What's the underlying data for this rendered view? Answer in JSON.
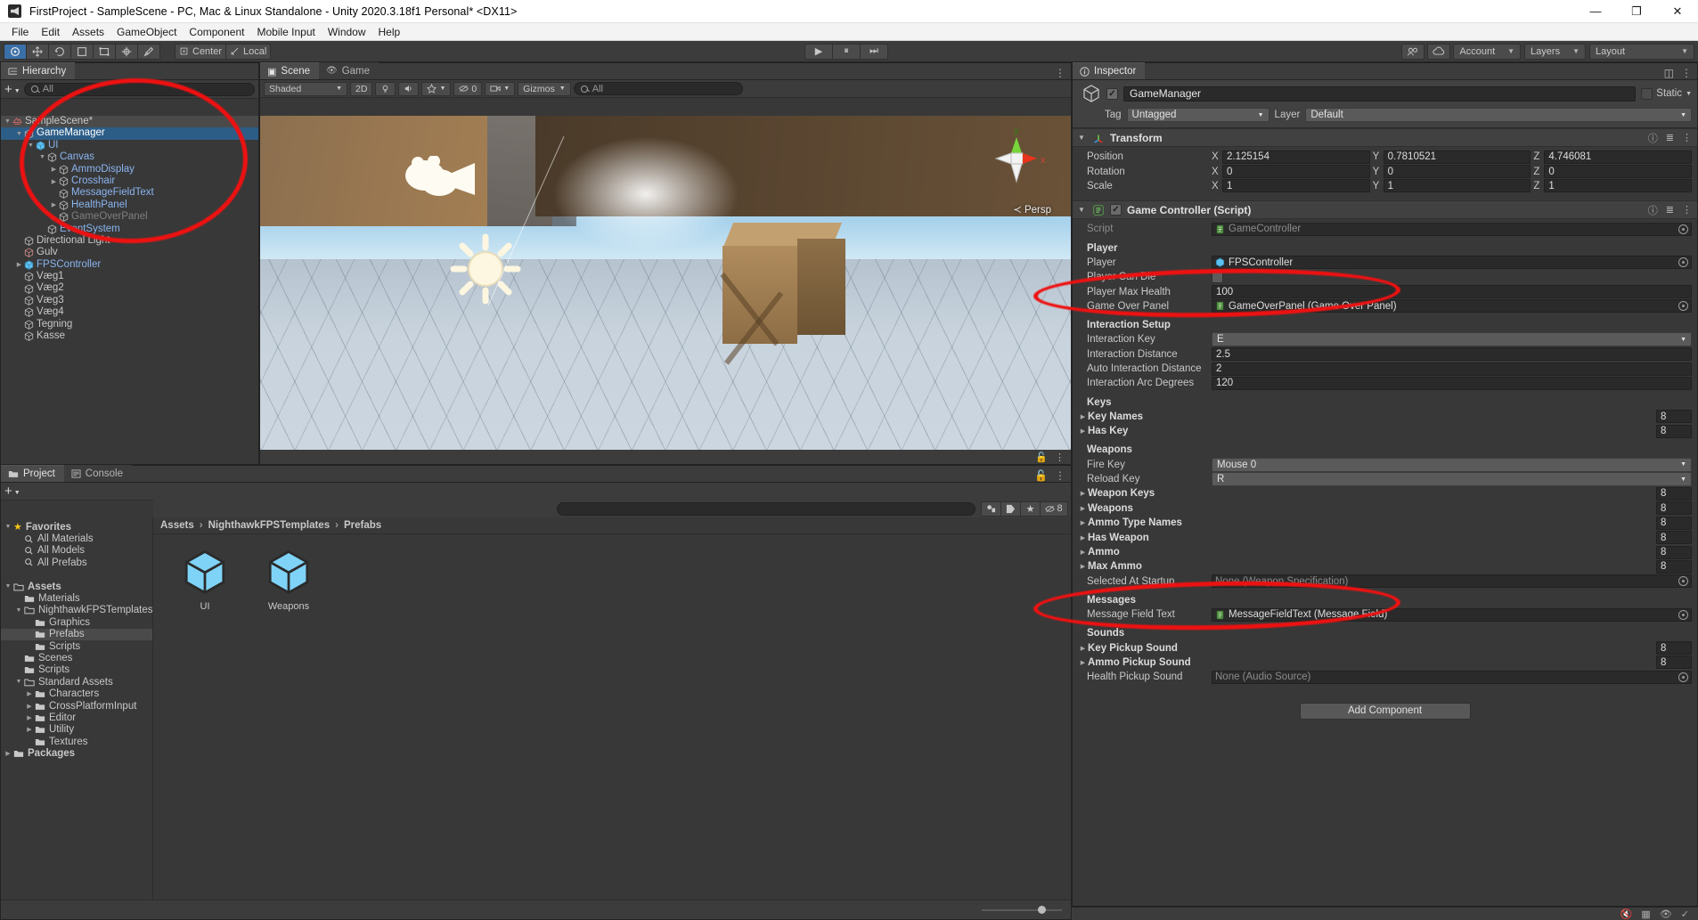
{
  "window": {
    "title": "FirstProject - SampleScene - PC, Mac & Linux Standalone - Unity 2020.3.18f1 Personal* <DX11>",
    "minimize": "—",
    "maximize": "❐",
    "close": "✕"
  },
  "menu": [
    "File",
    "Edit",
    "Assets",
    "GameObject",
    "Component",
    "Mobile Input",
    "Window",
    "Help"
  ],
  "toolbar": {
    "transform_tools": [
      "hand",
      "move",
      "rotate",
      "rect",
      "scale",
      "transform",
      "custom"
    ],
    "pivot_mode": "Center",
    "pivot_rotation": "Local",
    "play": "▶",
    "pause": "⏸",
    "step": "⏭",
    "collab": "Collab",
    "cloud": "cloud-icon",
    "account": "Account",
    "layers": "Layers",
    "layout": "Layout"
  },
  "hierarchy": {
    "tab": "Hierarchy",
    "search_placeholder": "All",
    "add_label": "+",
    "items": [
      {
        "label": "SampleScene*",
        "depth": 0,
        "arrow": "down",
        "icon": "scene-icon",
        "state": "scene"
      },
      {
        "label": "GameManager",
        "depth": 1,
        "arrow": "down",
        "icon": "cube-icon",
        "state": "selected"
      },
      {
        "label": "UI",
        "depth": 2,
        "arrow": "down",
        "icon": "prefab-icon",
        "state": "prefab"
      },
      {
        "label": "Canvas",
        "depth": 3,
        "arrow": "down",
        "icon": "cube-icon",
        "state": "child"
      },
      {
        "label": "AmmoDisplay",
        "depth": 4,
        "arrow": "right",
        "icon": "cube-icon",
        "state": "child"
      },
      {
        "label": "Crosshair",
        "depth": 4,
        "arrow": "right",
        "icon": "cube-icon",
        "state": "child"
      },
      {
        "label": "MessageFieldText",
        "depth": 4,
        "arrow": "none",
        "icon": "cube-icon",
        "state": "child"
      },
      {
        "label": "HealthPanel",
        "depth": 4,
        "arrow": "right",
        "icon": "cube-icon",
        "state": "child"
      },
      {
        "label": "GameOverPanel",
        "depth": 4,
        "arrow": "right",
        "icon": "cube-icon",
        "state": "disabled"
      },
      {
        "label": "EventSystem",
        "depth": 3,
        "arrow": "none",
        "icon": "cube-icon",
        "state": "child"
      },
      {
        "label": "Directional Light",
        "depth": 1,
        "arrow": "none",
        "icon": "cube-icon",
        "state": "normal"
      },
      {
        "label": "Gulv",
        "depth": 1,
        "arrow": "none",
        "icon": "cube-icon",
        "state": "normal"
      },
      {
        "label": "FPSController",
        "depth": 1,
        "arrow": "right",
        "icon": "prefab-icon",
        "state": "prefab"
      },
      {
        "label": "Væg1",
        "depth": 1,
        "arrow": "none",
        "icon": "cube-icon",
        "state": "normal"
      },
      {
        "label": "Væg2",
        "depth": 1,
        "arrow": "none",
        "icon": "cube-icon",
        "state": "normal"
      },
      {
        "label": "Væg3",
        "depth": 1,
        "arrow": "none",
        "icon": "cube-icon",
        "state": "normal"
      },
      {
        "label": "Væg4",
        "depth": 1,
        "arrow": "none",
        "icon": "cube-icon",
        "state": "normal"
      },
      {
        "label": "Tegning",
        "depth": 1,
        "arrow": "none",
        "icon": "cube-icon",
        "state": "normal"
      },
      {
        "label": "Kasse",
        "depth": 1,
        "arrow": "none",
        "icon": "cube-icon",
        "state": "normal"
      }
    ]
  },
  "scene": {
    "tabs": [
      {
        "label": "Scene",
        "icon": "scene-icon",
        "active": true
      },
      {
        "label": "Game",
        "icon": "game-icon",
        "active": false
      }
    ],
    "shading": "Shaded",
    "mode_2d": "2D",
    "gizmos": "Gizmos",
    "search_placeholder": "All",
    "audio_toggle": "audio-icon",
    "fx_toggle": "fx-icon",
    "count_badge": "0",
    "perspective_label": "Persp",
    "axis_labels": {
      "x": "x",
      "y": "y"
    }
  },
  "project": {
    "tabs": [
      {
        "label": "Project",
        "icon": "folder-icon",
        "active": true
      },
      {
        "label": "Console",
        "icon": "console-icon",
        "active": false
      }
    ],
    "search_placeholder": "",
    "hidden_count": "8",
    "breadcrumb": [
      "Assets",
      "NighthawkFPSTemplates",
      "Prefabs"
    ],
    "tree": [
      {
        "label": "Favorites",
        "depth": 0,
        "arrow": "down",
        "icon": "star-icon",
        "bold": true,
        "sel": false
      },
      {
        "label": "All Materials",
        "depth": 1,
        "arrow": "none",
        "icon": "search-icon",
        "bold": false,
        "sel": false
      },
      {
        "label": "All Models",
        "depth": 1,
        "arrow": "none",
        "icon": "search-icon",
        "bold": false,
        "sel": false
      },
      {
        "label": "All Prefabs",
        "depth": 1,
        "arrow": "none",
        "icon": "search-icon",
        "bold": false,
        "sel": false
      },
      {
        "label": "",
        "depth": 0,
        "arrow": "none",
        "icon": "none",
        "bold": false,
        "sel": false
      },
      {
        "label": "Assets",
        "depth": 0,
        "arrow": "down",
        "icon": "folder-open-icon",
        "bold": true,
        "sel": false
      },
      {
        "label": "Materials",
        "depth": 1,
        "arrow": "none",
        "icon": "folder-icon",
        "bold": false,
        "sel": false
      },
      {
        "label": "NighthawkFPSTemplates",
        "depth": 1,
        "arrow": "down",
        "icon": "folder-open-icon",
        "bold": false,
        "sel": false
      },
      {
        "label": "Graphics",
        "depth": 2,
        "arrow": "none",
        "icon": "folder-icon",
        "bold": false,
        "sel": false
      },
      {
        "label": "Prefabs",
        "depth": 2,
        "arrow": "none",
        "icon": "folder-icon",
        "bold": false,
        "sel": true
      },
      {
        "label": "Scripts",
        "depth": 2,
        "arrow": "none",
        "icon": "folder-icon",
        "bold": false,
        "sel": false
      },
      {
        "label": "Scenes",
        "depth": 1,
        "arrow": "none",
        "icon": "folder-icon",
        "bold": false,
        "sel": false
      },
      {
        "label": "Scripts",
        "depth": 1,
        "arrow": "none",
        "icon": "folder-icon",
        "bold": false,
        "sel": false
      },
      {
        "label": "Standard Assets",
        "depth": 1,
        "arrow": "down",
        "icon": "folder-open-icon",
        "bold": false,
        "sel": false
      },
      {
        "label": "Characters",
        "depth": 2,
        "arrow": "right",
        "icon": "folder-icon",
        "bold": false,
        "sel": false
      },
      {
        "label": "CrossPlatformInput",
        "depth": 2,
        "arrow": "right",
        "icon": "folder-icon",
        "bold": false,
        "sel": false
      },
      {
        "label": "Editor",
        "depth": 2,
        "arrow": "right",
        "icon": "folder-icon",
        "bold": false,
        "sel": false
      },
      {
        "label": "Utility",
        "depth": 2,
        "arrow": "right",
        "icon": "folder-icon",
        "bold": false,
        "sel": false
      },
      {
        "label": "Textures",
        "depth": 2,
        "arrow": "none",
        "icon": "folder-icon",
        "bold": false,
        "sel": false
      },
      {
        "label": "Packages",
        "depth": 0,
        "arrow": "right",
        "icon": "folder-icon",
        "bold": true,
        "sel": false
      }
    ],
    "assets": [
      {
        "label": "UI",
        "icon": "prefab-cube-icon"
      },
      {
        "label": "Weapons",
        "icon": "prefab-cube-icon"
      }
    ]
  },
  "inspector": {
    "tab": "Inspector",
    "object_name": "GameManager",
    "enabled": true,
    "static_label": "Static",
    "tag_label": "Tag",
    "tag_value": "Untagged",
    "layer_label": "Layer",
    "layer_value": "Default",
    "transform": {
      "title": "Transform",
      "rows": [
        {
          "label": "Position",
          "x": "2.125154",
          "y": "0.7810521",
          "z": "4.746081"
        },
        {
          "label": "Rotation",
          "x": "0",
          "y": "0",
          "z": "0"
        },
        {
          "label": "Scale",
          "x": "1",
          "y": "1",
          "z": "1"
        }
      ],
      "axes": [
        "X",
        "Y",
        "Z"
      ]
    },
    "game_controller": {
      "title": "Game Controller (Script)",
      "enabled": true,
      "script_label": "Script",
      "script_value": "GameController",
      "sections": [
        {
          "header": "Player",
          "fields": [
            {
              "label": "Player",
              "type": "object",
              "value": "FPSController",
              "icon": "prefab-icon"
            },
            {
              "label": "Player Can Die",
              "type": "checkbox",
              "value": ""
            },
            {
              "label": "Player Max Health",
              "type": "number",
              "value": "100"
            },
            {
              "label": "Game Over Panel",
              "type": "object",
              "value": "GameOverPanel (Game Over Panel)",
              "icon": "script-icon"
            }
          ]
        },
        {
          "header": "Interaction Setup",
          "fields": [
            {
              "label": "Interaction Key",
              "type": "dropdown",
              "value": "E"
            },
            {
              "label": "Interaction Distance",
              "type": "number",
              "value": "2.5"
            },
            {
              "label": "Auto Interaction Distance",
              "type": "number",
              "value": "2"
            },
            {
              "label": "Interaction Arc Degrees",
              "type": "number",
              "value": "120"
            }
          ]
        },
        {
          "header": "Keys",
          "fields": [
            {
              "label": "Key Names",
              "type": "array",
              "value": "8"
            },
            {
              "label": "Has Key",
              "type": "array",
              "value": "8"
            }
          ]
        },
        {
          "header": "Weapons",
          "fields": [
            {
              "label": "Fire Key",
              "type": "dropdown",
              "value": "Mouse 0"
            },
            {
              "label": "Reload Key",
              "type": "dropdown",
              "value": "R"
            },
            {
              "label": "Weapon Keys",
              "type": "array",
              "value": "8"
            },
            {
              "label": "Weapons",
              "type": "array",
              "value": "8"
            },
            {
              "label": "Ammo Type Names",
              "type": "array",
              "value": "8"
            },
            {
              "label": "Has Weapon",
              "type": "array",
              "value": "8"
            },
            {
              "label": "Ammo",
              "type": "array",
              "value": "8"
            },
            {
              "label": "Max Ammo",
              "type": "array",
              "value": "8"
            },
            {
              "label": "Selected At Startup",
              "type": "object-none",
              "value": "None (Weapon Specification)"
            }
          ]
        },
        {
          "header": "Messages",
          "fields": [
            {
              "label": "Message Field Text",
              "type": "object",
              "value": "MessageFieldText (Message Field)",
              "icon": "script-icon"
            }
          ]
        },
        {
          "header": "Sounds",
          "fields": [
            {
              "label": "Key Pickup Sound",
              "type": "array",
              "value": "8"
            },
            {
              "label": "Ammo Pickup Sound",
              "type": "array",
              "value": "8"
            },
            {
              "label": "Health Pickup Sound",
              "type": "object-none",
              "value": "None (Audio Source)"
            }
          ]
        }
      ]
    },
    "add_component": "Add Component"
  },
  "annotations": {
    "color": "#ee1111",
    "shapes": [
      {
        "name": "hierarchy-highlight",
        "target": "GameManager UI subtree"
      },
      {
        "name": "game-over-panel-highlight",
        "target": "Game Over Panel field"
      },
      {
        "name": "message-field-text-highlight",
        "target": "Message Field Text field"
      }
    ]
  }
}
